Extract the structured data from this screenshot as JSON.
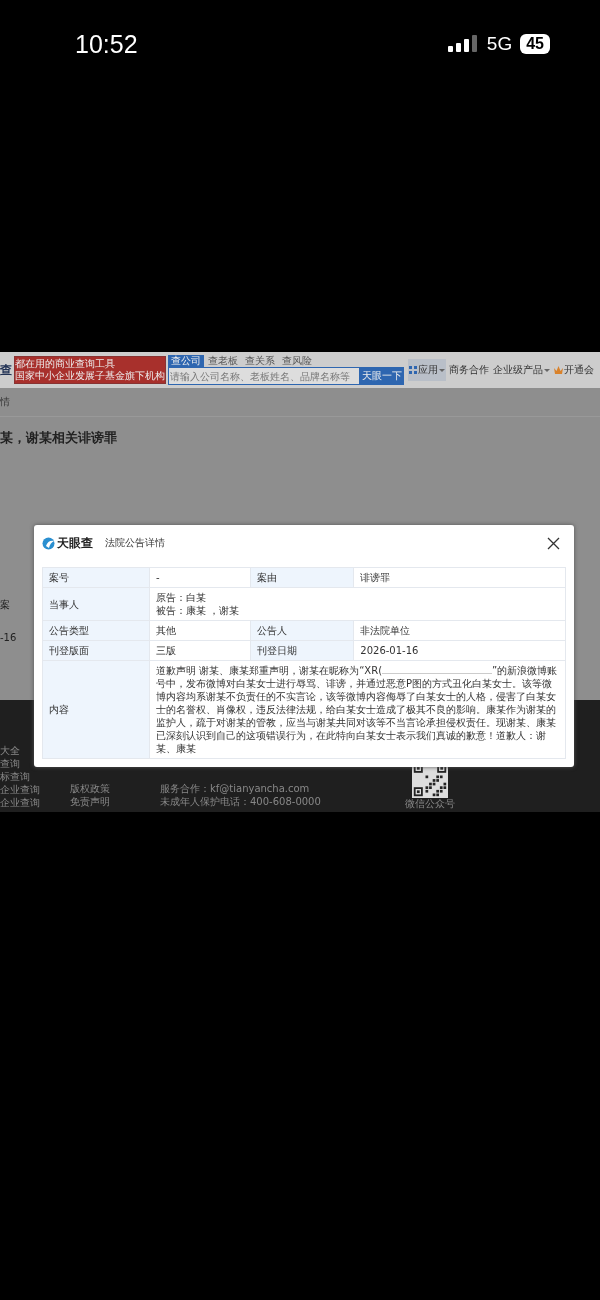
{
  "status_bar": {
    "time": "10:52",
    "network": "5G",
    "battery": "45"
  },
  "header": {
    "logo_fragment": "查",
    "banner": [
      "都在用的商业查询工具",
      "国家中小企业发展子基金旗下机构"
    ],
    "search_tabs": [
      {
        "label": "查公司",
        "selected": true
      },
      {
        "label": "查老板",
        "selected": false
      },
      {
        "label": "查关系",
        "selected": false
      },
      {
        "label": "查风险",
        "selected": false
      }
    ],
    "search_placeholder": "请输入公司名称、老板姓名、品牌名称等",
    "search_button": "天眼一下",
    "nav": [
      {
        "label": "应用",
        "kind": "apps",
        "selected": true
      },
      {
        "label": "商务合作",
        "kind": "link",
        "selected": false
      },
      {
        "label": "企业级产品",
        "kind": "dropdown",
        "selected": false
      },
      {
        "label": "开通会",
        "kind": "vip",
        "selected": false
      }
    ]
  },
  "breadcrumb": "情",
  "page_title": "某，谢某相关诽谤罪",
  "side_fragments": [
    "案",
    "-16"
  ],
  "footer": {
    "column_1": [
      "大全",
      "查询",
      "标查询",
      "企业查询",
      "企业查询"
    ],
    "column_2": [
      "版权政策",
      "免责声明"
    ],
    "column_3": [
      "服务合作：kf@tianyancha.com",
      "未成年人保护电话：400-608-0000"
    ],
    "qr_caption": "微信公众号"
  },
  "modal": {
    "logo": "天眼查",
    "title": "法院公告详情",
    "rows": [
      {
        "kind": "pair",
        "cells": [
          "案号",
          "-",
          "案由",
          "诽谤罪"
        ]
      },
      {
        "kind": "wide",
        "label": "当事人",
        "lines": [
          "原告：白某",
          "被告：康某 ，谢某"
        ]
      },
      {
        "kind": "pair",
        "cells": [
          "公告类型",
          "其他",
          "公告人",
          "非法院单位"
        ]
      },
      {
        "kind": "pair",
        "cells": [
          "刊登版面",
          "三版",
          "刊登日期",
          "2026-01-16"
        ]
      },
      {
        "kind": "content",
        "label": "内容",
        "text_before": "道歉声明 谢某、康某郑重声明，谢某在昵称为“XR(",
        "text_after": "”的新浪微博账号中，发布微博对白某女士进行辱骂、诽谤，并通过恶意P图的方式丑化白某女士。该等微博内容均系谢某不负责任的不实言论，该等微博内容侮辱了白某女士的人格，侵害了白某女士的名誉权、肖像权，违反法律法规，给白某女士造成了极其不良的影响。康某作为谢某的监护人，疏于对谢某的管教，应当与谢某共同对该等不当言论承担侵权责任。现谢某、康某已深刻认识到自己的这项错误行为，在此特向白某女士表示我们真诚的歉意！道歉人：谢某、康某"
      }
    ]
  }
}
